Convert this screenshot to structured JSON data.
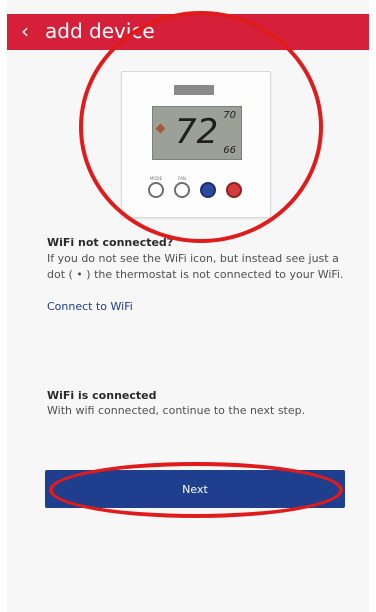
{
  "header": {
    "back_icon": "‹",
    "title": "add device",
    "bg_color": "#d6203a"
  },
  "thermostat": {
    "temperature": "72",
    "setpoint": "70",
    "humidity": "66",
    "button_label_1": "MODE",
    "button_label_2": "FAN"
  },
  "wifi_not_connected": {
    "heading": "WiFi not connected?",
    "body": "If you do not see the WiFi icon, but instead see just a dot ( • ) the thermostat is not connected to your WiFi."
  },
  "connect_link": "Connect to WiFi",
  "wifi_connected": {
    "heading": "WiFi is connected",
    "body": "With wifi connected, continue to the next step."
  },
  "next_button": {
    "label": "Next",
    "color": "#1f3e8d"
  },
  "annotations": {
    "highlight_color": "#e01b1b"
  }
}
